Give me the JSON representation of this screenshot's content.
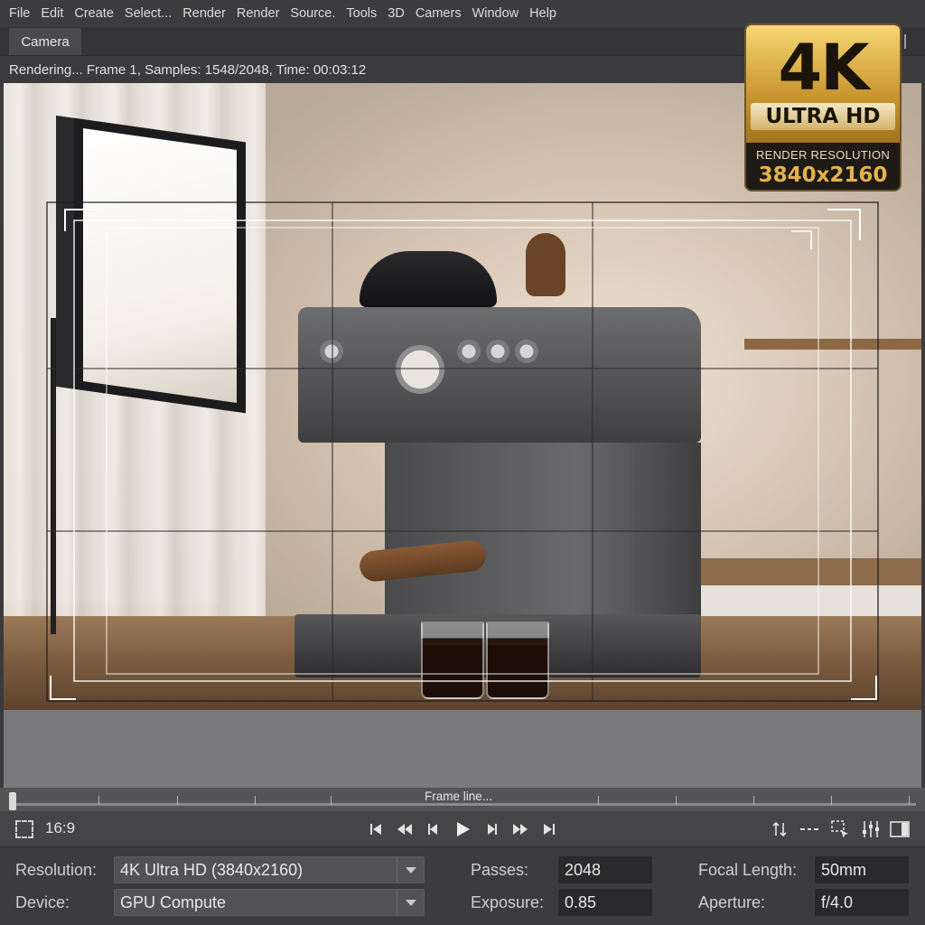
{
  "menu": [
    "File",
    "Edit",
    "Create",
    "Select...",
    "Render",
    "Render",
    "Source.",
    "Tools",
    "3D",
    "Camers",
    "Window",
    "Help"
  ],
  "tab": {
    "label": "Camera"
  },
  "status": {
    "text": "Rendering... Frame 1, Samples: 1548/2048, Time: 00:03:12"
  },
  "badge": {
    "big": "4K",
    "line2": "ULTRA HD",
    "line3": "RENDER RESOLUTION",
    "line4": "3840x2160"
  },
  "timeline": {
    "label": "Frame line...",
    "position": 0
  },
  "controls": {
    "aspect_label": "16:9"
  },
  "properties": {
    "resolution": {
      "label": "Resolution:",
      "value": "4K Ultra HD (3840x2160)"
    },
    "device": {
      "label": "Device:",
      "value": "GPU Compute"
    },
    "passes": {
      "label": "Passes:",
      "value": "2048"
    },
    "exposure": {
      "label": "Exposure:",
      "value": "0.85"
    },
    "focal_length": {
      "label": "Focal Length:",
      "value": "50mm"
    },
    "aperture": {
      "label": "Aperture:",
      "value": "f/4.0"
    }
  },
  "colors": {
    "accent_gold": "#e3b24a",
    "panel": "#3c3c3f",
    "field": "#2a2a2c"
  }
}
